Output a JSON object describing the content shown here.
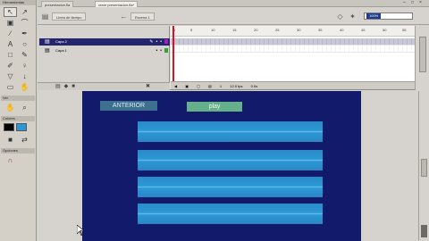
{
  "app": {
    "tabs": [
      {
        "label": "presentacion.fla"
      },
      {
        "label": "crear presentacion.fla*"
      }
    ]
  },
  "edit_bar": {
    "scene_label": "Linea de tiempo",
    "symbol_label": "Escena 1",
    "zoom_value": "100%"
  },
  "tools_panel": {
    "header": "Herramientas",
    "sections": {
      "view": "Ver",
      "colors": "Colores",
      "options": "Opciones"
    }
  },
  "timeline": {
    "layers": [
      {
        "name": "Capa 2",
        "active": true
      },
      {
        "name": "Capa 1",
        "active": false
      }
    ],
    "ruler_ticks": [
      "1",
      "5",
      "10",
      "15",
      "20",
      "25",
      "30",
      "35",
      "40",
      "45",
      "50",
      "55"
    ],
    "footer": {
      "frame": "1",
      "fps": "12.0 fps",
      "time": "0.0s"
    }
  },
  "stage": {
    "button_a_label": "ANTERIOR",
    "button_b_label": "play",
    "bar_count": 4,
    "background_color": "#121a6c",
    "bar_color": "#2c98d6"
  },
  "colors": {
    "accent_layer": "#24256e",
    "playhead": "#e01020",
    "stroke_swatch": "#000000",
    "fill_swatch": "#2c98d6"
  }
}
